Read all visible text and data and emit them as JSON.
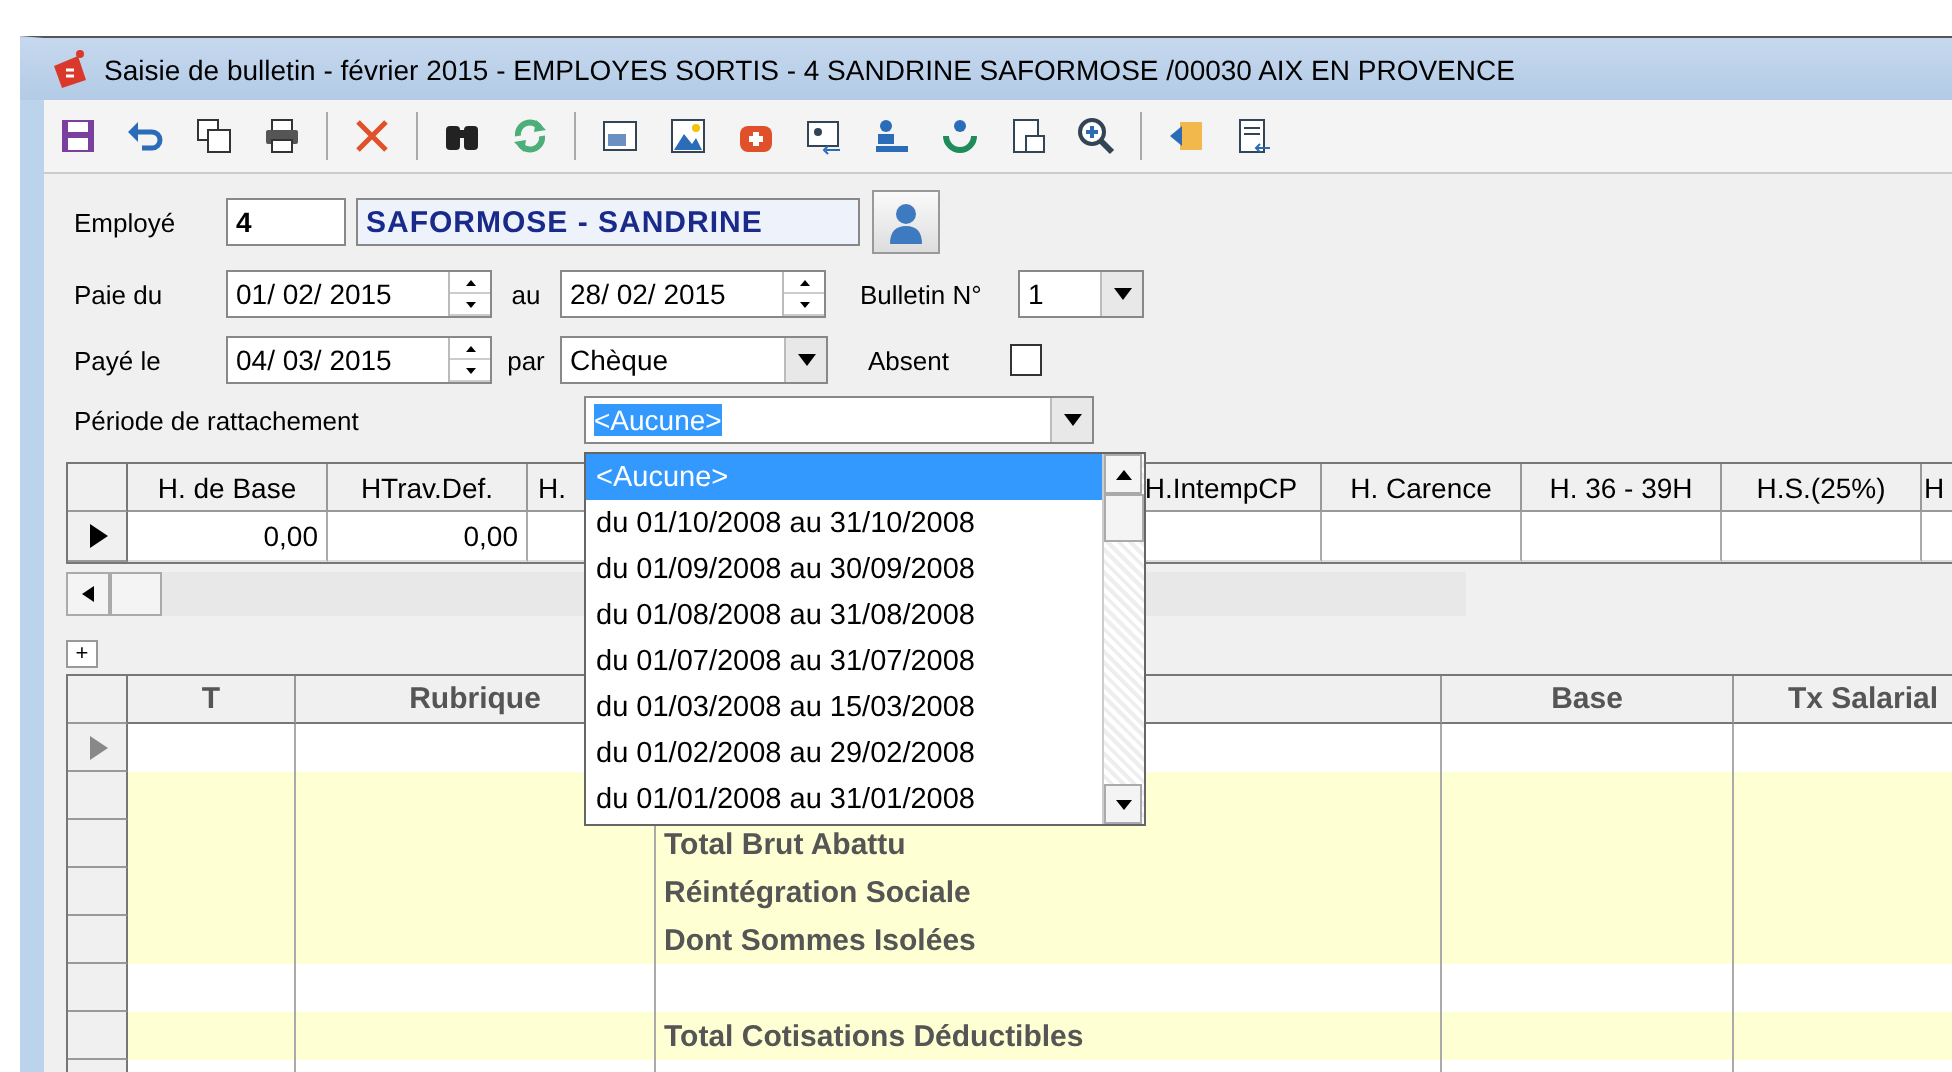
{
  "window": {
    "title": "Saisie de bulletin - février 2015 - EMPLOYES SORTIS - 4 SANDRINE SAFORMOSE /00030 AIX EN PROVENCE"
  },
  "form": {
    "employee_label": "Employé",
    "employee_code": "4",
    "employee_name": "SAFORMOSE - SANDRINE",
    "pay_from_label": "Paie du",
    "pay_from": "01/ 02/ 2015",
    "to_label": "au",
    "pay_to": "28/ 02/ 2015",
    "bulletin_label": "Bulletin N°",
    "bulletin_no": "1",
    "paid_label": "Payé le",
    "paid_on": "04/ 03/ 2015",
    "by_label": "par",
    "method": "Chèque",
    "absent_label": "Absent",
    "absent_checked": false,
    "period_label": "Période de rattachement",
    "period": "<Aucune>"
  },
  "period_dropdown": {
    "options": [
      {
        "label": "<Aucune>",
        "selected": true
      },
      {
        "label": "du 01/10/2008 au 31/10/2008",
        "selected": false
      },
      {
        "label": "du 01/09/2008 au 30/09/2008",
        "selected": false
      },
      {
        "label": "du 01/08/2008 au 31/08/2008",
        "selected": false
      },
      {
        "label": "du 01/07/2008 au 31/07/2008",
        "selected": false
      },
      {
        "label": "du 01/03/2008 au 15/03/2008",
        "selected": false
      },
      {
        "label": "du 01/02/2008 au 29/02/2008",
        "selected": false
      },
      {
        "label": "du 01/01/2008 au 31/01/2008",
        "selected": false
      }
    ]
  },
  "hours_grid": {
    "columns": [
      "H. de Base",
      "HTrav.Def.",
      "H.",
      "H.IntempCP",
      "H. Carence",
      "H. 36 - 39H",
      "H.S.(25%)",
      "H"
    ],
    "rows": [
      {
        "current": true,
        "values": [
          "0,00",
          "0,00"
        ]
      }
    ]
  },
  "expand_button": "+",
  "items_grid": {
    "columns": [
      "T",
      "Rubrique",
      "Base",
      "Tx Salarial"
    ],
    "rows": [
      {
        "current": true,
        "highlight": false
      },
      {
        "current": false,
        "highlight": true
      },
      {
        "current": false,
        "highlight": true,
        "label": "Total Brut Abattu"
      },
      {
        "current": false,
        "highlight": true,
        "label": "Réintégration Sociale"
      },
      {
        "current": false,
        "highlight": true,
        "label": "Dont Sommes Isolées"
      },
      {
        "current": false,
        "highlight": false
      },
      {
        "current": false,
        "highlight": true,
        "label": "Total Cotisations Déductibles"
      },
      {
        "highlight": false
      }
    ]
  }
}
